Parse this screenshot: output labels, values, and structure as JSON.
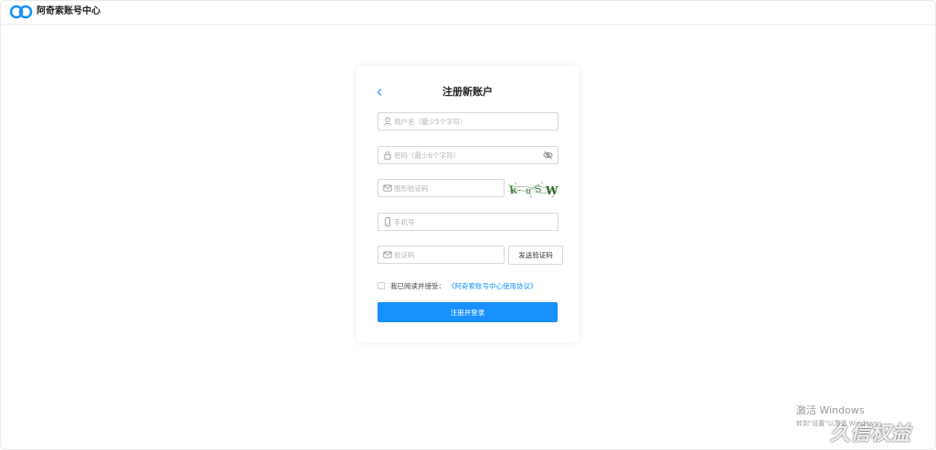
{
  "app": {
    "brand_name": "阿奇索账号中心",
    "brand_color": "#1890ff"
  },
  "form": {
    "back_icon": "chevron-left-icon",
    "title": "注册新账户",
    "username": {
      "placeholder": "用户名（最少5个字符）",
      "value": "",
      "icon": "user-icon"
    },
    "password": {
      "placeholder": "密码（最少6个字符）",
      "value": "",
      "icon": "lock-icon",
      "toggle_icon": "eye-off-icon"
    },
    "captcha": {
      "placeholder": "图形验证码",
      "value": "",
      "icon": "mail-icon",
      "image_text": "k-uS W"
    },
    "phone": {
      "placeholder": "手机号",
      "value": "",
      "icon": "mobile-icon"
    },
    "sms_code": {
      "placeholder": "验证码",
      "value": "",
      "icon": "mail-icon"
    },
    "send_code_label": "发送验证码",
    "agreement": {
      "checked": false,
      "text": "我已阅读并接受：",
      "link": "《阿奇索账号中心使用协议》"
    },
    "submit_label": "注册并登录"
  },
  "system": {
    "activate_title": "激活 Windows",
    "activate_hint": "转到\"设置\"以激活 Windows。",
    "watermark": "久信权益"
  }
}
